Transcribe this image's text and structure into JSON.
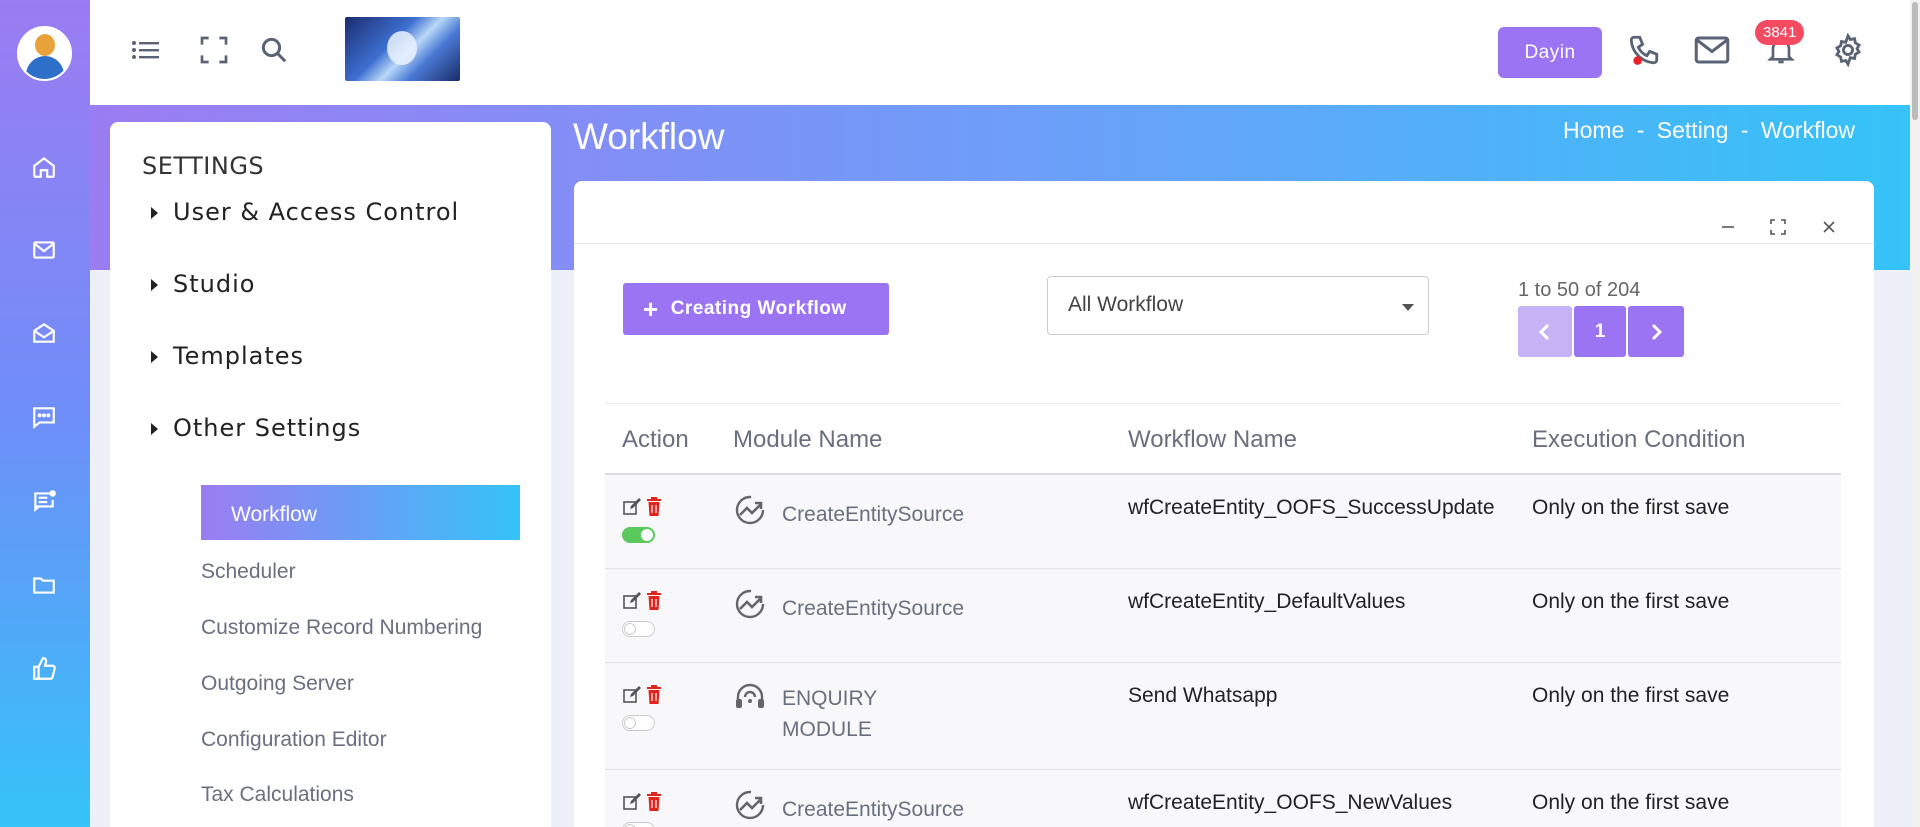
{
  "header": {
    "dayin_label": "Dayin",
    "notification_count": "3841"
  },
  "page": {
    "title": "Workflow",
    "breadcrumb": [
      "Home",
      "Setting",
      "Workflow"
    ],
    "breadcrumb_sep": "-"
  },
  "settings": {
    "heading": "SETTINGS",
    "groups": [
      "User & Access Control",
      "Studio",
      "Templates",
      "Other Settings"
    ],
    "items": [
      "Workflow",
      "Scheduler",
      "Customize Record Numbering",
      "Outgoing Server",
      "Configuration Editor",
      "Tax Calculations"
    ],
    "active_item": "Workflow"
  },
  "toolbar": {
    "create_label": "Creating Workflow",
    "filter_value": "All Workflow",
    "range_text": "1 to 50 of 204",
    "current_page": "1"
  },
  "table": {
    "headers": [
      "Action",
      "Module Name",
      "Workflow Name",
      "Execution Condition"
    ],
    "rows": [
      {
        "module": "CreateEntitySource",
        "module_icon": "trend-icon",
        "workflow": "wfCreateEntity_OOFS_SuccessUpdate",
        "condition": "Only on the first save",
        "enabled": true
      },
      {
        "module": "CreateEntitySource",
        "module_icon": "trend-icon",
        "workflow": "wfCreateEntity_DefaultValues",
        "condition": "Only on the first save",
        "enabled": false
      },
      {
        "module": "ENQUIRY MODULE",
        "module_icon": "headset-icon",
        "workflow": "Send Whatsapp",
        "condition": "Only on the first save",
        "enabled": false
      },
      {
        "module": "CreateEntitySource",
        "module_icon": "trend-icon",
        "workflow": "wfCreateEntity_OOFS_NewValues",
        "condition": "Only on the first save",
        "enabled": false
      }
    ]
  },
  "colors": {
    "accent": "#9b74f4",
    "gradient_start": "#9b7cf2",
    "gradient_end": "#35c3f8",
    "toggle_on": "#59c95c",
    "delete": "#e0241c",
    "badge": "#f44b62"
  }
}
